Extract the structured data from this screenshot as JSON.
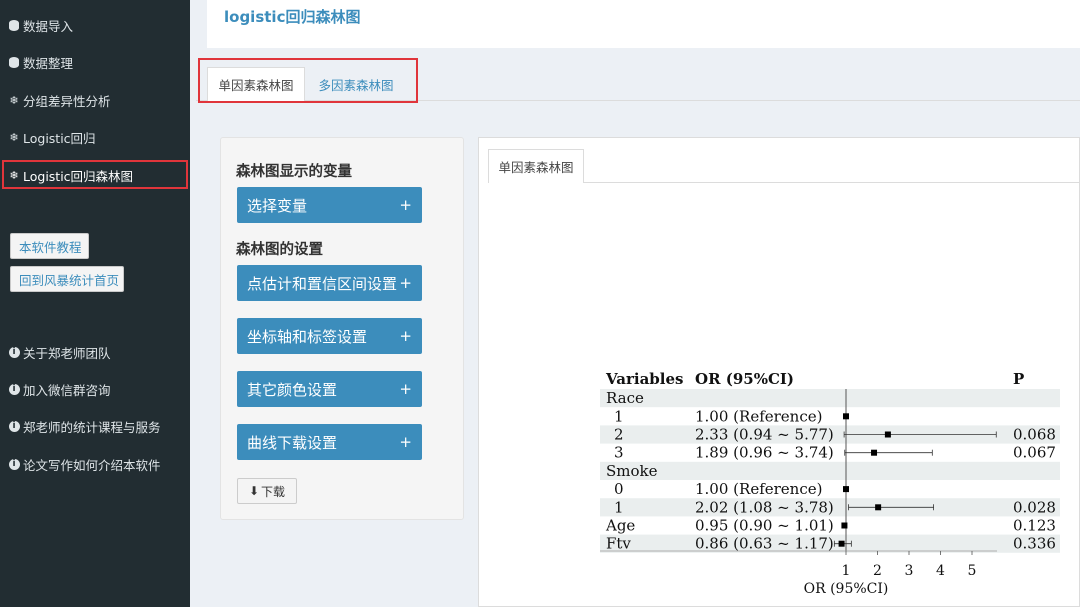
{
  "sidebar": {
    "items": [
      {
        "label": "数据导入",
        "icon": "database-icon"
      },
      {
        "label": "数据整理",
        "icon": "database-icon"
      },
      {
        "label": "分组差异性分析",
        "icon": "gear-icon"
      },
      {
        "label": "Logistic回归",
        "icon": "gear-icon"
      },
      {
        "label": "Logistic回归森林图",
        "icon": "gear-icon"
      }
    ],
    "buttons": [
      "本软件教程",
      "回到风暴统计首页"
    ],
    "info_items": [
      {
        "label": "关于郑老师团队",
        "icon": "info-circle-icon"
      },
      {
        "label": "加入微信群咨询",
        "icon": "info-circle-icon"
      },
      {
        "label": "郑老师的统计课程与服务",
        "icon": "info-circle-icon"
      },
      {
        "label": "论文写作如何介绍本软件",
        "icon": "info-circle-icon"
      }
    ]
  },
  "header": {
    "title": "logistic回归森林图"
  },
  "tabs": [
    {
      "label": "单因素森林图",
      "active": true
    },
    {
      "label": "多因素森林图",
      "active": false
    }
  ],
  "settings": {
    "section1": "森林图显示的变量",
    "choose_vars": "选择变量",
    "section2": "森林图的设置",
    "accordions": [
      "点估计和置信区间设置",
      "坐标轴和标签设置",
      "其它颜色设置",
      "曲线下载设置"
    ],
    "plus": "+",
    "download": "下载"
  },
  "output": {
    "tab": "单因素森林图"
  },
  "forest": {
    "headers": {
      "variables": "Variables",
      "or": "OR (95%CI)",
      "p": "P"
    },
    "rows": [
      {
        "var": "Race",
        "or": "",
        "p": "",
        "level": 0,
        "shaded": true
      },
      {
        "var": "1",
        "or": "1.00 (Reference)",
        "p": "",
        "level": 1,
        "shaded": false,
        "est": 1.0
      },
      {
        "var": "2",
        "or": "2.33 (0.94 ~ 5.77)",
        "p": "0.068",
        "level": 1,
        "shaded": true,
        "est": 2.33,
        "lo": 0.94,
        "hi": 5.77
      },
      {
        "var": "3",
        "or": "1.89 (0.96 ~ 3.74)",
        "p": "0.067",
        "level": 1,
        "shaded": false,
        "est": 1.89,
        "lo": 0.96,
        "hi": 3.74
      },
      {
        "var": "Smoke",
        "or": "",
        "p": "",
        "level": 0,
        "shaded": true
      },
      {
        "var": "0",
        "or": "1.00 (Reference)",
        "p": "",
        "level": 1,
        "shaded": false,
        "est": 1.0
      },
      {
        "var": "1",
        "or": "2.02 (1.08 ~ 3.78)",
        "p": "0.028",
        "level": 1,
        "shaded": true,
        "est": 2.02,
        "lo": 1.08,
        "hi": 3.78
      },
      {
        "var": "Age",
        "or": "0.95 (0.90 ~ 1.01)",
        "p": "0.123",
        "level": 0,
        "shaded": false,
        "est": 0.95,
        "lo": 0.9,
        "hi": 1.01
      },
      {
        "var": "Ftv",
        "or": "0.86 (0.63 ~ 1.17)",
        "p": "0.336",
        "level": 0,
        "shaded": true,
        "est": 0.86,
        "lo": 0.63,
        "hi": 1.17
      }
    ],
    "axis": {
      "ticks": [
        1,
        2,
        3,
        4,
        5
      ],
      "label": "OR (95%CI)",
      "ref": 1
    }
  }
}
